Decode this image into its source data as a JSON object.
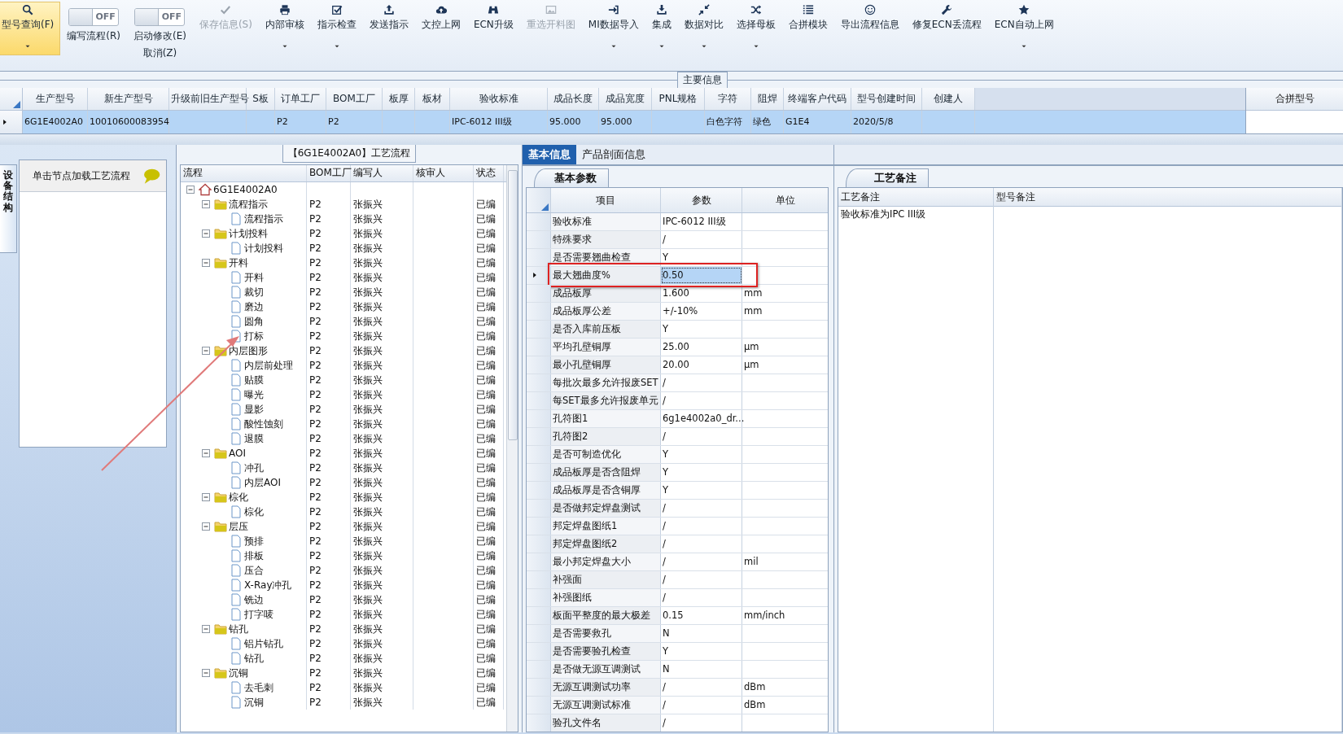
{
  "toolbar": {
    "buttons": [
      {
        "kind": "icon",
        "label": "型号查询(F)",
        "selected": true,
        "disabled": false,
        "dropdown": true
      },
      {
        "kind": "toggle",
        "toggle_text": "OFF",
        "on": false,
        "lines": [
          "编写流程(R)"
        ]
      },
      {
        "kind": "toggle",
        "toggle_text": "OFF",
        "on": false,
        "lines": [
          "启动修改(E)",
          "取消(Z)"
        ]
      },
      {
        "kind": "icon",
        "label": "保存信息(S)",
        "selected": false,
        "disabled": true,
        "dropdown": false
      },
      {
        "kind": "icon",
        "label": "内部审核",
        "selected": false,
        "disabled": false,
        "dropdown": true
      },
      {
        "kind": "icon",
        "label": "指示检查",
        "selected": false,
        "disabled": false,
        "dropdown": true
      },
      {
        "kind": "icon",
        "label": "发送指示",
        "selected": false,
        "disabled": false,
        "dropdown": false
      },
      {
        "kind": "icon",
        "label": "文控上网",
        "selected": false,
        "disabled": false,
        "dropdown": false
      },
      {
        "kind": "icon",
        "label": "ECN升级",
        "selected": false,
        "disabled": false,
        "dropdown": false
      },
      {
        "kind": "icon",
        "label": "重选开料图",
        "selected": false,
        "disabled": true,
        "dropdown": false
      },
      {
        "kind": "icon",
        "label": "MI数据导入",
        "selected": false,
        "disabled": false,
        "dropdown": true
      },
      {
        "kind": "icon",
        "label": "集成",
        "selected": false,
        "disabled": false,
        "dropdown": true
      },
      {
        "kind": "icon",
        "label": "数据对比",
        "selected": false,
        "disabled": false,
        "dropdown": true
      },
      {
        "kind": "icon",
        "label": "选择母板",
        "selected": false,
        "disabled": false,
        "dropdown": true
      },
      {
        "kind": "icon",
        "label": "合拼模块",
        "selected": false,
        "disabled": false,
        "dropdown": false
      },
      {
        "kind": "icon",
        "label": "导出流程信息",
        "selected": false,
        "disabled": false,
        "dropdown": false
      },
      {
        "kind": "icon",
        "label": "修复ECN丢流程",
        "selected": false,
        "disabled": false,
        "dropdown": false
      },
      {
        "kind": "icon",
        "label": "ECN自动上网",
        "selected": false,
        "disabled": false,
        "dropdown": true
      }
    ]
  },
  "main_info": {
    "legend": "主要信息",
    "columns": [
      "生产型号",
      "新生产型号",
      "升级前旧生产型号",
      "S板",
      "订单工厂",
      "BOM工厂",
      "板厚",
      "板材",
      "验收标准",
      "成品长度",
      "成品宽度",
      "PNL规格",
      "字符",
      "阻焊",
      "终端客户代码",
      "型号创建时间",
      "创建人"
    ],
    "rows": [
      {
        "selected": true,
        "cells": [
          {
            "text": "6G1E4002A0"
          },
          {
            "text": "10010600083954"
          },
          {},
          {},
          {
            "text": "P2"
          },
          {
            "text": "P2"
          },
          {},
          {},
          {
            "text": "IPC-6012 III级"
          },
          {
            "text": "95.000"
          },
          {
            "text": "95.000"
          },
          {},
          {
            "text": "白色字符"
          },
          {
            "text": "绿色"
          },
          {
            "text": "G1E4"
          },
          {
            "text": "2020/5/8"
          },
          {}
        ]
      }
    ],
    "side_column": "合拼型号"
  },
  "side_panel": {
    "vertical_tab": "设备结构",
    "hint": "单击节点加载工艺流程"
  },
  "process_tree": {
    "title": "【6G1E4002A0】工艺流程",
    "columns": [
      "流程",
      "BOM工厂",
      "编写人",
      "核审人",
      "状态"
    ],
    "root": {
      "label": "6G1E4002A0",
      "expanded": true,
      "children": [
        {
          "label": "流程指示",
          "bom": "P2",
          "writer": "张振兴",
          "status": "已编",
          "expanded": true,
          "children": [
            {
              "label": "流程指示",
              "bom": "P2",
              "writer": "张振兴",
              "status": "已编"
            }
          ]
        },
        {
          "label": "计划投料",
          "bom": "P2",
          "writer": "张振兴",
          "status": "已编",
          "expanded": true,
          "children": [
            {
              "label": "计划投料",
              "bom": "P2",
              "writer": "张振兴",
              "status": "已编"
            }
          ]
        },
        {
          "label": "开料",
          "bom": "P2",
          "writer": "张振兴",
          "status": "已编",
          "expanded": true,
          "children": [
            {
              "label": "开料",
              "bom": "P2",
              "writer": "张振兴",
              "status": "已编"
            },
            {
              "label": "裁切",
              "bom": "P2",
              "writer": "张振兴",
              "status": "已编"
            },
            {
              "label": "磨边",
              "bom": "P2",
              "writer": "张振兴",
              "status": "已编"
            },
            {
              "label": "圆角",
              "bom": "P2",
              "writer": "张振兴",
              "status": "已编"
            },
            {
              "label": "打标",
              "bom": "P2",
              "writer": "张振兴",
              "status": "已编",
              "annotated": true
            }
          ]
        },
        {
          "label": "内层图形",
          "bom": "P2",
          "writer": "张振兴",
          "status": "已编",
          "expanded": true,
          "children": [
            {
              "label": "内层前处理",
              "bom": "P2",
              "writer": "张振兴",
              "status": "已编"
            },
            {
              "label": "贴膜",
              "bom": "P2",
              "writer": "张振兴",
              "status": "已编"
            },
            {
              "label": "曝光",
              "bom": "P2",
              "writer": "张振兴",
              "status": "已编"
            },
            {
              "label": "显影",
              "bom": "P2",
              "writer": "张振兴",
              "status": "已编"
            },
            {
              "label": "酸性蚀刻",
              "bom": "P2",
              "writer": "张振兴",
              "status": "已编"
            },
            {
              "label": "退膜",
              "bom": "P2",
              "writer": "张振兴",
              "status": "已编"
            }
          ]
        },
        {
          "label": "AOI",
          "bom": "P2",
          "writer": "张振兴",
          "status": "已编",
          "expanded": true,
          "children": [
            {
              "label": "冲孔",
              "bom": "P2",
              "writer": "张振兴",
              "status": "已编"
            },
            {
              "label": "内层AOI",
              "bom": "P2",
              "writer": "张振兴",
              "status": "已编"
            }
          ]
        },
        {
          "label": "棕化",
          "bom": "P2",
          "writer": "张振兴",
          "status": "已编",
          "expanded": true,
          "children": [
            {
              "label": "棕化",
              "bom": "P2",
              "writer": "张振兴",
              "status": "已编"
            }
          ]
        },
        {
          "label": "层压",
          "bom": "P2",
          "writer": "张振兴",
          "status": "已编",
          "expanded": true,
          "children": [
            {
              "label": "预排",
              "bom": "P2",
              "writer": "张振兴",
              "status": "已编"
            },
            {
              "label": "排板",
              "bom": "P2",
              "writer": "张振兴",
              "status": "已编"
            },
            {
              "label": "压合",
              "bom": "P2",
              "writer": "张振兴",
              "status": "已编"
            },
            {
              "label": "X-Ray冲孔",
              "bom": "P2",
              "writer": "张振兴",
              "status": "已编"
            },
            {
              "label": "铣边",
              "bom": "P2",
              "writer": "张振兴",
              "status": "已编"
            },
            {
              "label": "打字唛",
              "bom": "P2",
              "writer": "张振兴",
              "status": "已编"
            }
          ]
        },
        {
          "label": "钻孔",
          "bom": "P2",
          "writer": "张振兴",
          "status": "已编",
          "expanded": true,
          "children": [
            {
              "label": "铝片钻孔",
              "bom": "P2",
              "writer": "张振兴",
              "status": "已编"
            },
            {
              "label": "钻孔",
              "bom": "P2",
              "writer": "张振兴",
              "status": "已编"
            }
          ]
        },
        {
          "label": "沉铜",
          "bom": "P2",
          "writer": "张振兴",
          "status": "已编",
          "expanded": true,
          "children": [
            {
              "label": "去毛刺",
              "bom": "P2",
              "writer": "张振兴",
              "status": "已编"
            },
            {
              "label": "沉铜",
              "bom": "P2",
              "writer": "张振兴",
              "status": "已编"
            }
          ]
        }
      ]
    }
  },
  "params": {
    "tabs": [
      {
        "label": "基本信息",
        "selected": true
      },
      {
        "label": "产品剖面信息",
        "selected": false
      }
    ],
    "subtab": "基本参数",
    "columns": [
      "项目",
      "参数",
      "单位"
    ],
    "rows": [
      {
        "item": "验收标准",
        "value": "IPC-6012 III级",
        "selected": false
      },
      {
        "item": "特殊要求",
        "value": "/",
        "selected": false
      },
      {
        "item": "是否需要翘曲检查",
        "value": "Y",
        "selected": false
      },
      {
        "item": "最大翘曲度%",
        "value": "0.50",
        "selected": true,
        "annotated": true
      },
      {
        "item": "成品板厚",
        "value": "1.600",
        "unit": "mm",
        "selected": false
      },
      {
        "item": "成品板厚公差",
        "value": "+/-10%",
        "unit": "mm",
        "selected": false
      },
      {
        "item": "是否入库前压板",
        "value": "Y",
        "selected": false
      },
      {
        "item": "平均孔壁铜厚",
        "value": "25.00",
        "unit": "μm",
        "selected": false
      },
      {
        "item": "最小孔壁铜厚",
        "value": "20.00",
        "unit": "μm",
        "selected": false
      },
      {
        "item": "每批次最多允许报废SET",
        "value": "/",
        "selected": false
      },
      {
        "item": "每SET最多允许报废单元",
        "value": "/",
        "selected": false
      },
      {
        "item": "孔符图1",
        "value": "6g1e4002a0_dr...",
        "selected": false
      },
      {
        "item": "孔符图2",
        "value": "/",
        "selected": false
      },
      {
        "item": "是否可制造优化",
        "value": "Y",
        "selected": false
      },
      {
        "item": "成品板厚是否含阻焊",
        "value": "Y",
        "selected": false
      },
      {
        "item": "成品板厚是否含铜厚",
        "value": "Y",
        "selected": false
      },
      {
        "item": "是否做邦定焊盘测试",
        "value": "/",
        "selected": false
      },
      {
        "item": "邦定焊盘图纸1",
        "value": "/",
        "selected": false
      },
      {
        "item": "邦定焊盘图纸2",
        "value": "/",
        "selected": false
      },
      {
        "item": "最小邦定焊盘大小",
        "value": "/",
        "unit": "mil",
        "selected": false
      },
      {
        "item": "补强面",
        "value": "/",
        "selected": false
      },
      {
        "item": "补强图纸",
        "value": "/",
        "selected": false
      },
      {
        "item": "板面平整度的最大极差",
        "value": "0.15",
        "unit": "mm/inch",
        "selected": false
      },
      {
        "item": "是否需要救孔",
        "value": "N",
        "selected": false
      },
      {
        "item": "是否需要验孔检查",
        "value": "Y",
        "selected": false
      },
      {
        "item": "是否做无源互调测试",
        "value": "N",
        "selected": false
      },
      {
        "item": "无源互调测试功率",
        "value": "/",
        "unit": "dBm",
        "selected": false
      },
      {
        "item": "无源互调测试标准",
        "value": "/",
        "unit": "dBm",
        "selected": false
      },
      {
        "item": "验孔文件名",
        "value": "/",
        "selected": false
      }
    ]
  },
  "notes": {
    "tab": "工艺备注",
    "columns": [
      "工艺备注",
      "型号备注"
    ],
    "process_note": "验收标准为IPC III级"
  }
}
